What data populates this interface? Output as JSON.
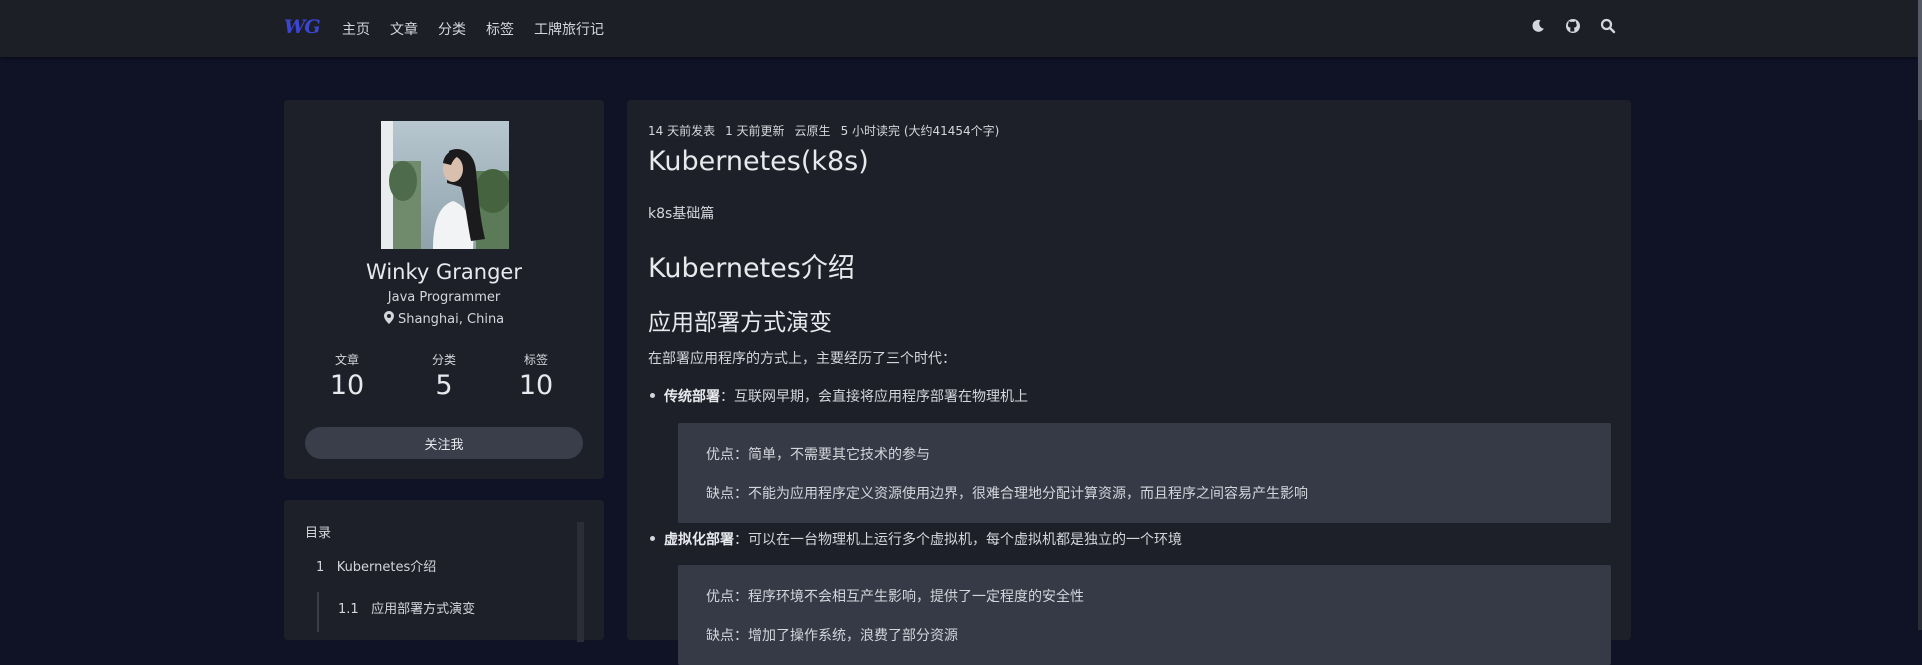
{
  "nav": {
    "logo": "WG",
    "links": [
      "主页",
      "文章",
      "分类",
      "标签",
      "工牌旅行记"
    ],
    "icons": [
      "moon-icon",
      "github-icon",
      "search-icon"
    ]
  },
  "profile": {
    "name": "Winky Granger",
    "title": "Java Programmer",
    "location": "Shanghai, China",
    "stats": [
      {
        "label": "文章",
        "value": "10"
      },
      {
        "label": "分类",
        "value": "5"
      },
      {
        "label": "标签",
        "value": "10"
      }
    ],
    "follow_label": "关注我"
  },
  "toc": {
    "title": "目录",
    "items": [
      {
        "num": "1",
        "text": "Kubernetes介绍"
      },
      {
        "num": "1.1",
        "text": "应用部署方式演变"
      }
    ]
  },
  "article": {
    "meta": [
      "14 天前发表",
      "1 天前更新",
      "云原生",
      "5 小时读完 (大约41454个字)"
    ],
    "title": "Kubernetes(k8s)",
    "summary": "k8s基础篇",
    "h1": "Kubernetes介绍",
    "h2": "应用部署方式演变",
    "intro": "在部署应用程序的方式上，主要经历了三个时代：",
    "bullets": [
      {
        "term": "传统部署",
        "desc": "：互联网早期，会直接将应用程序部署在物理机上",
        "pros": "优点：简单，不需要其它技术的参与",
        "cons": "缺点：不能为应用程序定义资源使用边界，很难合理地分配计算资源，而且程序之间容易产生影响"
      },
      {
        "term": "虚拟化部署",
        "desc": "：可以在一台物理机上运行多个虚拟机，每个虚拟机都是独立的一个环境",
        "pros": "优点：程序环境不会相互产生影响，提供了一定程度的安全性",
        "cons": "缺点：增加了操作系统，浪费了部分资源"
      }
    ]
  }
}
